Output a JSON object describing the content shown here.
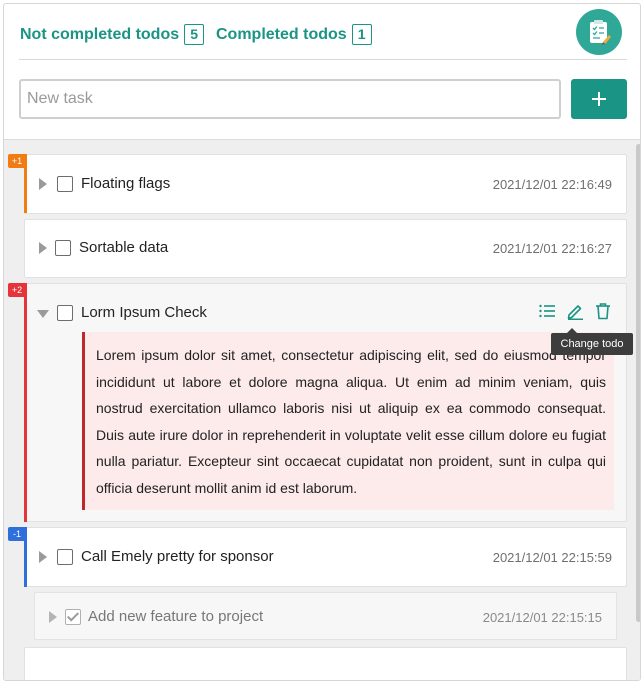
{
  "header": {
    "tabs": [
      {
        "label": "Not completed todos",
        "count": "5"
      },
      {
        "label": "Completed todos",
        "count": "1"
      }
    ],
    "logo_icon": "checklist-pencil-icon"
  },
  "new_task": {
    "placeholder": "New task",
    "value": "",
    "add_label": "+"
  },
  "colors": {
    "accent": "#1a9484",
    "flag_orange": "#f07c13",
    "flag_red": "#e5353b",
    "flag_blue": "#2f6fdc",
    "desc_bg": "#fdeaea",
    "desc_border": "#c0272d"
  },
  "todos": [
    {
      "title": "Floating flags",
      "time": "2021/12/01 22:16:49",
      "badge": "+1",
      "flag_color": "#f07c13",
      "expanded": false,
      "checked": false
    },
    {
      "title": "Sortable data",
      "time": "2021/12/01 22:16:27",
      "badge": "",
      "flag_color": "",
      "expanded": false,
      "checked": false
    },
    {
      "title": "Lorm Ipsum Check",
      "time": "",
      "badge": "+2",
      "flag_color": "#e5353b",
      "expanded": true,
      "checked": false,
      "description": "Lorem ipsum dolor sit amet, consectetur adipiscing elit, sed do eiusmod tempor incididunt ut labore et dolore magna aliqua. Ut enim ad minim veniam, quis nostrud exercitation ullamco laboris nisi ut aliquip ex ea commodo consequat. Duis aute irure dolor in reprehenderit in voluptate velit esse cillum dolore eu fugiat nulla pariatur. Excepteur sint occaecat cupidatat non proident, sunt in culpa qui officia deserunt mollit anim id est laborum.",
      "actions": [
        "list-icon",
        "edit-pencil-icon",
        "trash-icon"
      ],
      "tooltip": "Change todo"
    },
    {
      "title": "Call Emely pretty for sponsor",
      "time": "2021/12/01 22:15:59",
      "badge": "-1",
      "flag_color": "#2f6fdc",
      "expanded": false,
      "checked": false,
      "subtasks": [
        {
          "title": "Add new feature to project",
          "time": "2021/12/01 22:15:15",
          "checked": true
        }
      ]
    }
  ]
}
